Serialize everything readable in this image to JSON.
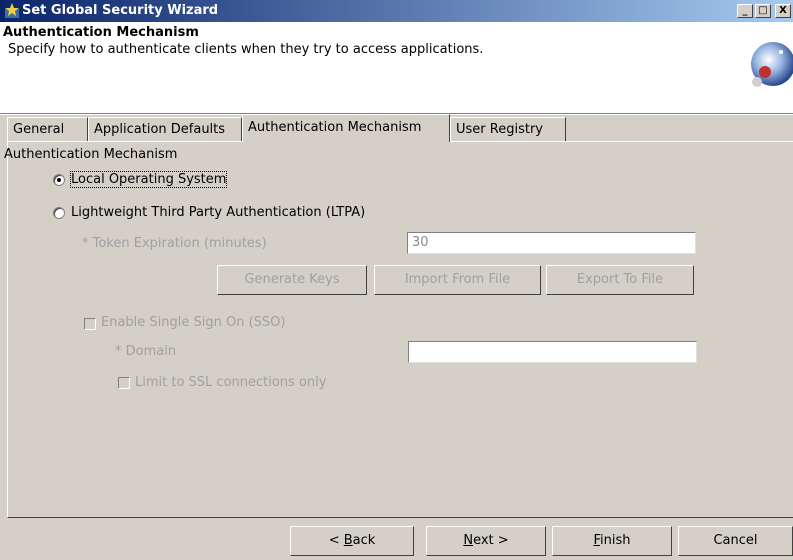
{
  "window": {
    "title": "Set Global Security Wizard",
    "minimize": "_",
    "maximize": "□",
    "close": "X"
  },
  "header": {
    "title": "Authentication Mechanism",
    "description": "Specify how to authenticate clients when they try to access applications."
  },
  "tabs": [
    {
      "label": "General"
    },
    {
      "label": "Application Defaults"
    },
    {
      "label": "Authentication Mechanism",
      "active": true
    },
    {
      "label": "User Registry"
    }
  ],
  "panel": {
    "group_label": "Authentication Mechanism",
    "radio_local": {
      "label": "Local Operating System",
      "selected": true
    },
    "radio_ltpa": {
      "label": "Lightweight Third Party Authentication (LTPA)",
      "selected": false
    },
    "token_label": "* Token Expiration (minutes)",
    "token_value": "30",
    "generate_keys": "Generate Keys",
    "import_file": "Import From File",
    "export_file": "Export To File",
    "sso_label": "Enable Single Sign On (SSO)",
    "domain_label": "* Domain",
    "domain_value": "",
    "ssl_label": "Limit to SSL connections only"
  },
  "footer": {
    "back_pre": "< ",
    "back_key": "B",
    "back_rest": "ack",
    "next_key": "N",
    "next_rest": "ext >",
    "finish_key": "F",
    "finish_rest": "inish",
    "cancel": "Cancel"
  }
}
